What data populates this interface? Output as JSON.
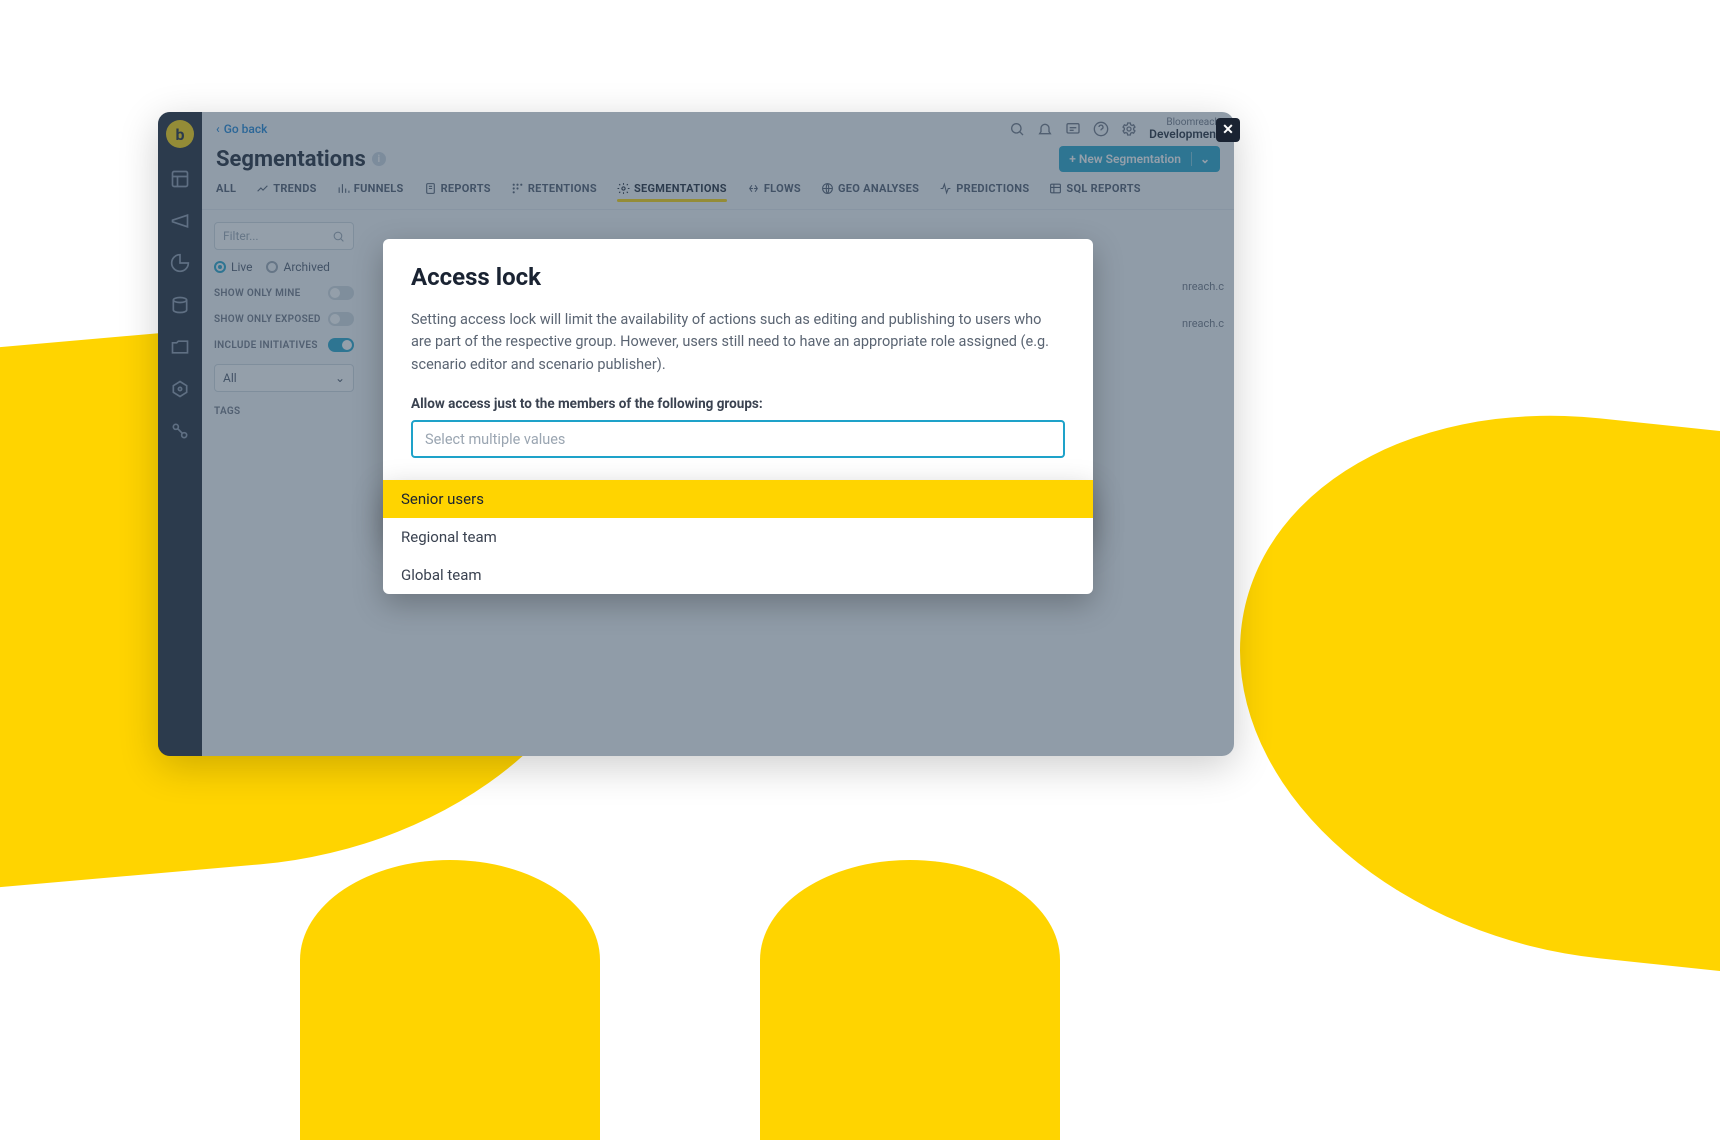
{
  "goback": "Go back",
  "org_sub": "Bloomreach",
  "org_main": "Development",
  "page_title": "Segmentations",
  "new_btn": "+ New Segmentation",
  "tabs": {
    "all": "ALL",
    "trends": "TRENDS",
    "funnels": "FUNNELS",
    "reports": "REPORTS",
    "retentions": "RETENTIONS",
    "segmentations": "SEGMENTATIONS",
    "flows": "FLOWS",
    "geo": "GEO ANALYSES",
    "predictions": "PREDICTIONS",
    "sql": "SQL REPORTS"
  },
  "filters": {
    "placeholder": "Filter...",
    "live": "Live",
    "archived": "Archived",
    "show_mine": "SHOW ONLY MINE",
    "show_exposed": "SHOW ONLY EXPOSED",
    "include_init": "INCLUDE INITIATIVES",
    "all_select": "All",
    "tags": "TAGS"
  },
  "row_peek1": "nreach.c",
  "row_peek2": "nreach.c",
  "modal": {
    "title": "Access lock",
    "desc": "Setting access lock will limit the availability of actions such as editing and publishing to users who are part of the respective group. However, users still need to have an appropriate role assigned (e.g. scenario editor and scenario publisher).",
    "label": "Allow access just to the members of the following groups:",
    "placeholder": "Select multiple values"
  },
  "dropdown": {
    "opt1": "Senior users",
    "opt2": "Regional team",
    "opt3": "Global team"
  }
}
